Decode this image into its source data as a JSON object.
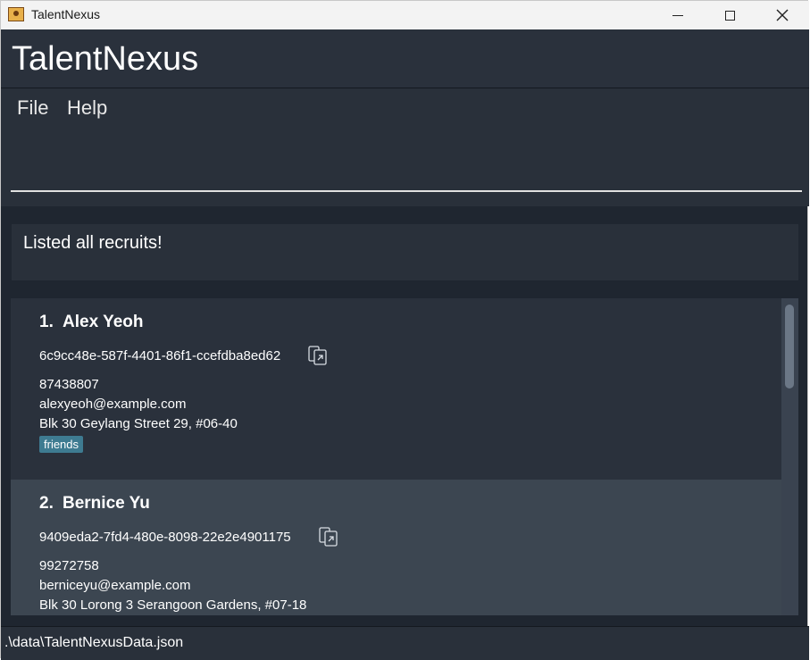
{
  "window": {
    "title": "TalentNexus",
    "controls": {
      "minimize": "minimize",
      "maximize": "maximize",
      "close": "close"
    }
  },
  "app": {
    "title": "TalentNexus",
    "menu": [
      "File",
      "Help"
    ]
  },
  "command": {
    "value": "",
    "placeholder": ""
  },
  "result": {
    "message": "Listed all recruits!"
  },
  "recruits": [
    {
      "index": "1.",
      "name": "Alex Yeoh",
      "id": "6c9cc48e-587f-4401-86f1-ccefdba8ed62",
      "phone": "87438807",
      "email": "alexyeoh@example.com",
      "address": "Blk 30 Geylang Street 29, #06-40",
      "tags": [
        "friends"
      ]
    },
    {
      "index": "2.",
      "name": "Bernice Yu",
      "id": "9409eda2-7fd4-480e-8098-22e2e4901175",
      "phone": "99272758",
      "email": "berniceyu@example.com",
      "address": "Blk 30 Lorong 3 Serangoon Gardens, #07-18",
      "tags": []
    }
  ],
  "status": {
    "path": ".\\data\\TalentNexusData.json"
  },
  "colors": {
    "background": "#1f2630",
    "panel": "#29303a",
    "card_alt": "#3c4651",
    "tag": "#3e7b91"
  },
  "icons": {
    "copy": "copy-link-icon",
    "app": "app-contact-icon"
  }
}
